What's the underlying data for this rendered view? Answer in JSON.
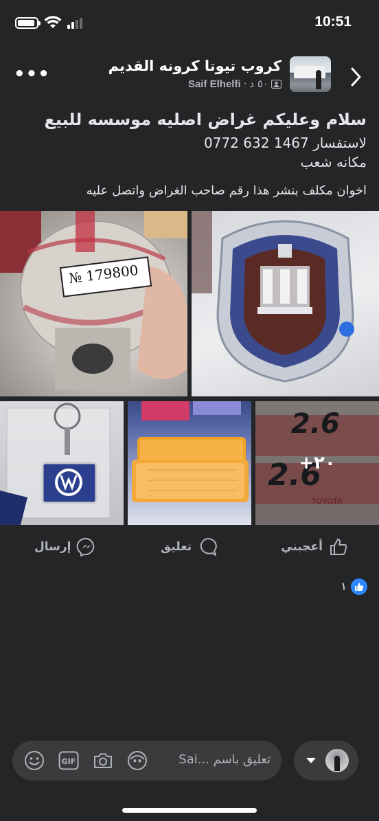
{
  "status_bar": {
    "time": "10:51"
  },
  "header": {
    "group_name": "كروب تيوتا كرونه القديم",
    "author": "Saif Elhelfi",
    "time_ago": "٥٠ د",
    "separator": "·"
  },
  "post": {
    "line1": "سلام وعليكم غراض اصليه موسسه للبيع",
    "line2": "لاستفسار 1467 632 0772",
    "line3": "مكانه شعب",
    "line4": "اخوان مكلف بنشر هذا رقم صاحب الغراض واتصل عليه"
  },
  "photos": {
    "tag_number": "№ 179800",
    "badge_left": "2.6",
    "badge_right": "2.6",
    "toyota_label": "TOYOTA",
    "more_count": "+٢٠"
  },
  "actions": {
    "like": "أعجبني",
    "comment": "تعليق",
    "send": "إرسال"
  },
  "reactions": {
    "count": "١"
  },
  "composer": {
    "placeholder": "تعليق باسم ...Sai"
  }
}
